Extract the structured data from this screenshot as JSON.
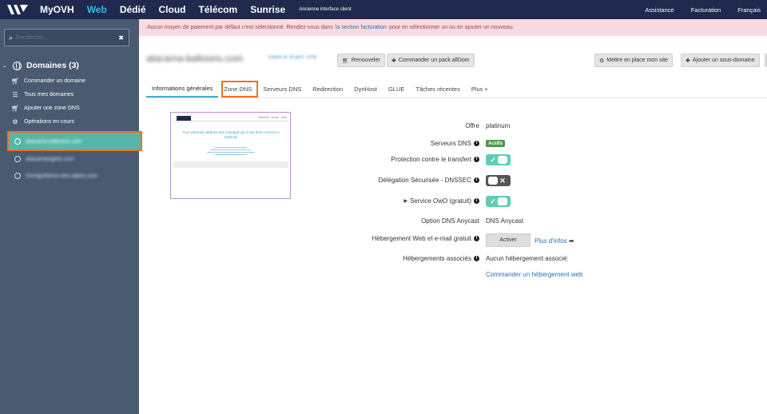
{
  "topbar": {
    "brand": "MyOVH",
    "nav": [
      "Web",
      "Dédié",
      "Cloud",
      "Télécom",
      "Sunrise"
    ],
    "active_nav": "Web",
    "old_interface": "Ancienne interface client",
    "right": [
      "Assistance",
      "Facturation",
      "Français"
    ]
  },
  "sidebar": {
    "search_placeholder": "Recherche...",
    "domains_header": "Domaines (3)",
    "actions": [
      {
        "label": "Commander un domaine",
        "icon": "cart-icon"
      },
      {
        "label": "Tous mes domaines",
        "icon": "list-icon"
      },
      {
        "label": "Ajouter une zone DNS",
        "icon": "cart-icon"
      },
      {
        "label": "Opérations en cours",
        "icon": "gears-icon"
      }
    ],
    "domains": [
      "atacama-balloons.com",
      "atacamanights.com",
      "montgolfieres-des-alpes.com"
    ]
  },
  "alert": {
    "before": "Aucun moyen de paiement par défaut n'est sélectionné. Rendez-vous dans",
    "link": "la section facturation",
    "after": "pour en sélectionner un ou en ajouter un nouveau."
  },
  "domain": {
    "title": "atacama-balloons.com",
    "subtitle": "Expiré le 28 janv. 2018"
  },
  "buttons": {
    "renew": "Renouveler",
    "order_pack": "Commander un pack allDom",
    "setup_site": "Mettre en place mon site",
    "add_subdomain": "Ajouter un sous-domaine"
  },
  "tabs": [
    "Informations générales",
    "Zone DNS",
    "Serveurs DNS",
    "Redirection",
    "DynHost",
    "GLUE",
    "Tâches récentes",
    "Plus +"
  ],
  "preview": {
    "text": "Your webmail address has changed yet it has been moved to webmail",
    "header_right": "Webmail · Accès · Aide"
  },
  "details": {
    "offre_label": "Offre",
    "offre_value": "platinum",
    "dns_servers_label": "Serveurs DNS",
    "dns_servers_badge": "Actifs",
    "transfer_label": "Protection contre le transfert",
    "dnssec_label": "Délégation Sécurisée - DNSSEC",
    "owo_label": "Service OwO (gratuit)",
    "anycast_label": "Option DNS Anycast",
    "anycast_value": "DNS Anycast",
    "hosting_label": "Hébergement Web et e-mail gratuit",
    "activate_button": "Activer",
    "more_info": "Plus d'infos",
    "associated_label": "Hébergements associés",
    "associated_value": "Aucun hébergement associé:",
    "order_hosting": "Commander un hébergement web"
  },
  "colors": {
    "topbar": "#1f2a4e",
    "sidebar": "#495a71",
    "selected": "#56b7a8",
    "highlight": "#f0711f",
    "toggle_on": "#5ecfb3"
  }
}
